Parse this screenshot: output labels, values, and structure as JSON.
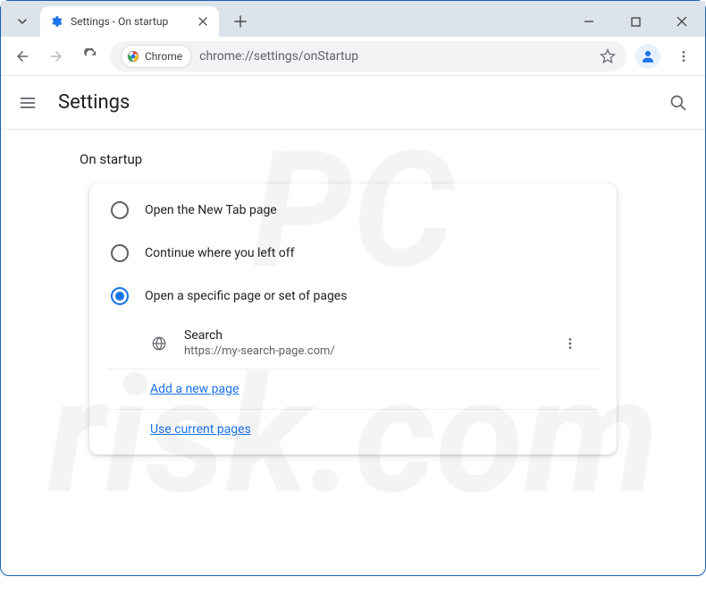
{
  "window": {
    "tab_title": "Settings - On startup"
  },
  "toolbar": {
    "chrome_chip": "Chrome",
    "url": "chrome://settings/onStartup"
  },
  "header": {
    "title": "Settings"
  },
  "section": {
    "title": "On startup",
    "options": {
      "new_tab": "Open the New Tab page",
      "continue": "Continue where you left off",
      "specific": "Open a specific page or set of pages"
    },
    "page": {
      "name": "Search",
      "url": "https://my-search-page.com/"
    },
    "add_link": "Add a new page",
    "use_current": "Use current pages"
  }
}
